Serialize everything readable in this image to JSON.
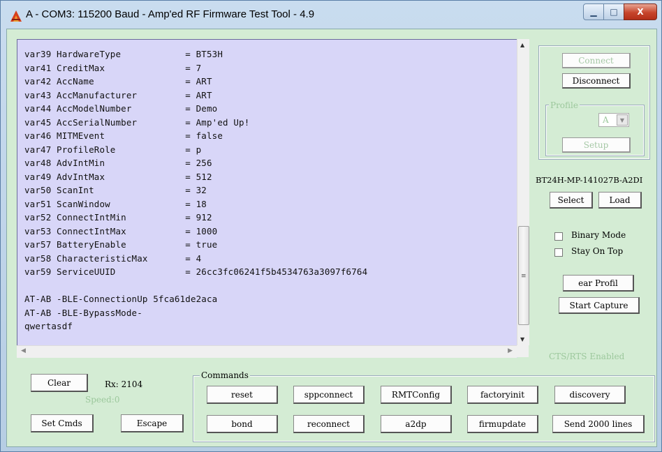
{
  "window": {
    "title": "A - COM3: 115200 Baud - Amp'ed RF Firmware Test Tool - 4.9",
    "minimize_glyph": "▁",
    "maximize_glyph": "□",
    "close_glyph": "X"
  },
  "console": {
    "lines": [
      "var39 HardwareType            = BT53H",
      "var41 CreditMax               = 7",
      "var42 AccName                 = ART",
      "var43 AccManufacturer         = ART",
      "var44 AccModelNumber          = Demo",
      "var45 AccSerialNumber         = Amp'ed Up!",
      "var46 MITMEvent               = false",
      "var47 ProfileRole             = p",
      "var48 AdvIntMin               = 256",
      "var49 AdvIntMax               = 512",
      "var50 ScanInt                 = 32",
      "var51 ScanWindow              = 18",
      "var52 ConnectIntMin           = 912",
      "var53 ConnectIntMax           = 1000",
      "var57 BatteryEnable           = true",
      "var58 CharacteristicMax       = 4",
      "var59 ServiceUUID             = 26cc3fc06241f5b4534763a3097f6764",
      "",
      "AT-AB -BLE-ConnectionUp 5fca61de2aca",
      "AT-AB -BLE-BypassMode-",
      "qwertasdf"
    ]
  },
  "right_panel": {
    "connect": "Connect",
    "disconnect": "Disconnect",
    "profile_label": "Profile",
    "profile_value": "A",
    "setup": "Setup",
    "firmware_name": "BT24H-MP-141027B-A2DI",
    "select": "Select",
    "load": "Load",
    "binary_mode": "Binary Mode",
    "stay_on_top": "Stay On Top",
    "clear_profile": "ear Profil",
    "start_capture": "Start Capture",
    "cts_rts": "CTS/RTS Enabled"
  },
  "bottom_left": {
    "clear": "Clear",
    "rx": "Rx: 2104",
    "speed": "Speed:0",
    "set_cmds": "Set Cmds",
    "escape": "Escape"
  },
  "commands": {
    "label": "Commands",
    "row1": [
      "reset",
      "sppconnect",
      "RMTConfig",
      "factoryinit",
      "discovery"
    ],
    "row2": [
      "bond",
      "reconnect",
      "a2dp",
      "firmupdate",
      "Send 2000 lines"
    ]
  }
}
